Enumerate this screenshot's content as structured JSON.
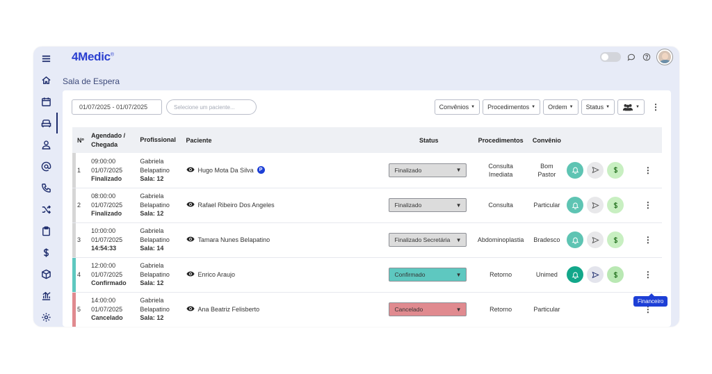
{
  "app": {
    "logo_text": "4Medic",
    "logo_tm": "®",
    "page_title": "Sala de Espera"
  },
  "sidebar": {
    "items": [
      {
        "icon": "menu-icon"
      },
      {
        "icon": "home-icon"
      },
      {
        "icon": "calendar-icon"
      },
      {
        "icon": "waiting-room-icon",
        "active": true
      },
      {
        "icon": "user-icon"
      },
      {
        "icon": "at-icon"
      },
      {
        "icon": "phone-icon"
      },
      {
        "icon": "shuffle-icon"
      },
      {
        "icon": "clipboard-icon"
      },
      {
        "icon": "dollar-icon"
      },
      {
        "icon": "box-icon"
      },
      {
        "icon": "chart-icon"
      },
      {
        "icon": "gear-icon"
      }
    ]
  },
  "toolbar": {
    "date_range": "01/07/2025 - 01/07/2025",
    "search_placeholder": "Selecione um paciente...",
    "filters": [
      "Convênios",
      "Procedimentos",
      "Ordem",
      "Status"
    ]
  },
  "table": {
    "headers": {
      "num": "Nº",
      "scheduled": "Agendado / Chegada",
      "professional": "Profissional",
      "patient": "Paciente",
      "status": "Status",
      "procedures": "Procedimentos",
      "insurance": "Convênio"
    },
    "rows": [
      {
        "num": "1",
        "time": "09:00:00",
        "date": "01/07/2025",
        "arrival": "Finalizado",
        "prof1": "Gabriela",
        "prof2": "Belapatino",
        "room": "Sala: 12",
        "patient": "Hugo Mota Da Silva",
        "badge": "P",
        "status": "Finalizado",
        "status_color": "#dcdcdc",
        "bar_color": "#d6d6d6",
        "proc1": "Consulta",
        "proc2": "Imediata",
        "conv1": "Bom",
        "conv2": "Pastor",
        "actions": true
      },
      {
        "num": "2",
        "time": "08:00:00",
        "date": "01/07/2025",
        "arrival": "Finalizado",
        "prof1": "Gabriela",
        "prof2": "Belapatino",
        "room": "Sala: 12",
        "patient": "Rafael Ribeiro Dos Angeles",
        "badge": "",
        "status": "Finalizado",
        "status_color": "#dcdcdc",
        "bar_color": "#d6d6d6",
        "proc1": "Consulta",
        "proc2": "",
        "conv1": "Particular",
        "conv2": "",
        "actions": true
      },
      {
        "num": "3",
        "time": "10:00:00",
        "date": "01/07/2025",
        "arrival": "14:54:33",
        "prof1": "Gabriela",
        "prof2": "Belapatino",
        "room": "Sala: 14",
        "patient": "Tamara Nunes Belapatino",
        "badge": "",
        "status": "Finalizado Secretária",
        "status_color": "#dcdcdc",
        "bar_color": "#d6d6d6",
        "proc1": "Abdominoplastia",
        "proc2": "",
        "conv1": "Bradesco",
        "conv2": "",
        "actions": true
      },
      {
        "num": "4",
        "time": "12:00:00",
        "date": "01/07/2025",
        "arrival": "Confirmado",
        "prof1": "Gabriela",
        "prof2": "Belapatino",
        "room": "Sala: 12",
        "patient": "Enrico Araujo",
        "badge": "",
        "status": "Confirmado",
        "status_color": "#5ec8c0",
        "bar_color": "#5ec8c0",
        "proc1": "Retorno",
        "proc2": "",
        "conv1": "Unimed",
        "conv2": "",
        "actions": true,
        "strong": true
      },
      {
        "num": "5",
        "time": "14:00:00",
        "date": "01/07/2025",
        "arrival": "Cancelado",
        "prof1": "Gabriela",
        "prof2": "Belapatino",
        "room": "Sala: 12",
        "patient": "Ana Beatriz Felisberto",
        "badge": "",
        "status": "Cancelado",
        "status_color": "#e08a8f",
        "bar_color": "#e08a8f",
        "proc1": "Retorno",
        "proc2": "",
        "conv1": "Particular",
        "conv2": "",
        "actions": false
      }
    ]
  },
  "tooltip": "Financeiro"
}
